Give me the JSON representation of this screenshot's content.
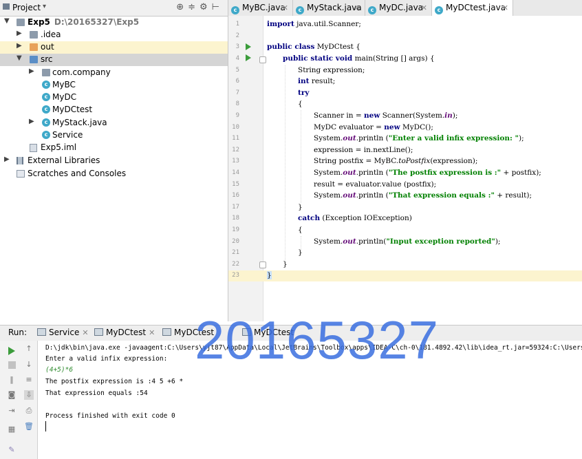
{
  "project_panel": {
    "title": "Project",
    "tree": [
      {
        "label": "Exp5",
        "path": "D:\\20165327\\Exp5",
        "arrow": "▼",
        "icon": "folder",
        "bold": true
      },
      {
        "label": ".idea",
        "arrow": "▶",
        "icon": "folder"
      },
      {
        "label": "out",
        "arrow": "▶",
        "icon": "folder-orange"
      },
      {
        "label": "src",
        "arrow": "▼",
        "icon": "folder-src"
      },
      {
        "label": "com.company",
        "arrow": "▶",
        "icon": "package"
      },
      {
        "label": "MyBC",
        "arrow": "",
        "icon": "class"
      },
      {
        "label": "MyDC",
        "arrow": "",
        "icon": "class"
      },
      {
        "label": "MyDCtest",
        "arrow": "",
        "icon": "class"
      },
      {
        "label": "MyStack.java",
        "arrow": "▶",
        "icon": "class"
      },
      {
        "label": "Service",
        "arrow": "",
        "icon": "class"
      },
      {
        "label": "Exp5.iml",
        "arrow": "",
        "icon": "file"
      },
      {
        "label": "External Libraries",
        "arrow": "▶",
        "icon": "library"
      },
      {
        "label": "Scratches and Consoles",
        "arrow": "",
        "icon": "scratches"
      }
    ]
  },
  "editor_tabs": [
    {
      "label": "MyBC.java",
      "active": false
    },
    {
      "label": "MyStack.java",
      "active": false
    },
    {
      "label": "MyDC.java",
      "active": false
    },
    {
      "label": "MyDCtest.java",
      "active": true
    }
  ],
  "editor": {
    "line_numbers": [
      "1",
      "2",
      "3",
      "4",
      "5",
      "6",
      "7",
      "8",
      "9",
      "10",
      "11",
      "12",
      "13",
      "14",
      "15",
      "16",
      "17",
      "18",
      "19",
      "20",
      "21",
      "22",
      "23"
    ],
    "code": {
      "l1_kw": "import",
      "l1_rest": " java.util.Scanner;",
      "l3_kw": "public class",
      "l3_rest": " MyDCtest {",
      "l4_kw": "public static void",
      "l4_rest": " main(String [] args) {",
      "l5": "String expression;",
      "l6_kw": "int",
      "l6_rest": " result;",
      "l7_kw": "try",
      "l8": "{",
      "l9_a": "Scanner in = ",
      "l9_kw": "new",
      "l9_b": " Scanner(System.",
      "l9_st": "in",
      "l9_c": ");",
      "l10_a": "MyDC evaluator = ",
      "l10_kw": "new",
      "l10_b": " MyDC();",
      "l11_a": "System.",
      "l11_st": "out",
      "l11_b": ".println (",
      "l11_str": "\"Enter a valid infix expression: \"",
      "l11_c": ");",
      "l12": "expression = in.nextLine();",
      "l13_a": "String postfix = MyBC.",
      "l13_it": "toPostfix",
      "l13_b": "(expression);",
      "l14_a": "System.",
      "l14_st": "out",
      "l14_b": ".println (",
      "l14_str": "\"The postfix expression is :\"",
      "l14_c": " + postfix);",
      "l15": "result = evaluator.value (postfix);",
      "l16_a": "System.",
      "l16_st": "out",
      "l16_b": ".println (",
      "l16_str": "\"That expression equals :\"",
      "l16_c": " + result);",
      "l17": "}",
      "l18_kw": "catch",
      "l18_rest": " (Exception IOException)",
      "l19": "{",
      "l20_a": "System.",
      "l20_st": "out",
      "l20_b": ".println(",
      "l20_str": "\"Input exception reported\"",
      "l20_c": ");",
      "l21": "}",
      "l22": "}",
      "l23": "}"
    }
  },
  "run_panel": {
    "label": "Run:",
    "tabs": [
      {
        "label": "Service"
      },
      {
        "label": "MyDCtest"
      },
      {
        "label": "MyDCtest"
      },
      {
        "label": "MyDCtest"
      }
    ],
    "console": {
      "cmd": "D:\\jdk\\bin\\java.exe -javaagent:C:\\Users\\yjt87\\AppData\\Local\\JetBrains\\Toolbox\\apps\\IDEA-C\\ch-0\\181.4892.42\\lib\\idea_rt.jar=59324:C:\\Users\\y",
      "prompt": "Enter a valid infix expression:",
      "input": "(4+5)*6",
      "postfix": "The postfix expression is :4 5 +6 *",
      "result": "That expression equals :54",
      "exit": "Process finished with exit code 0"
    }
  },
  "watermark": "20165327"
}
